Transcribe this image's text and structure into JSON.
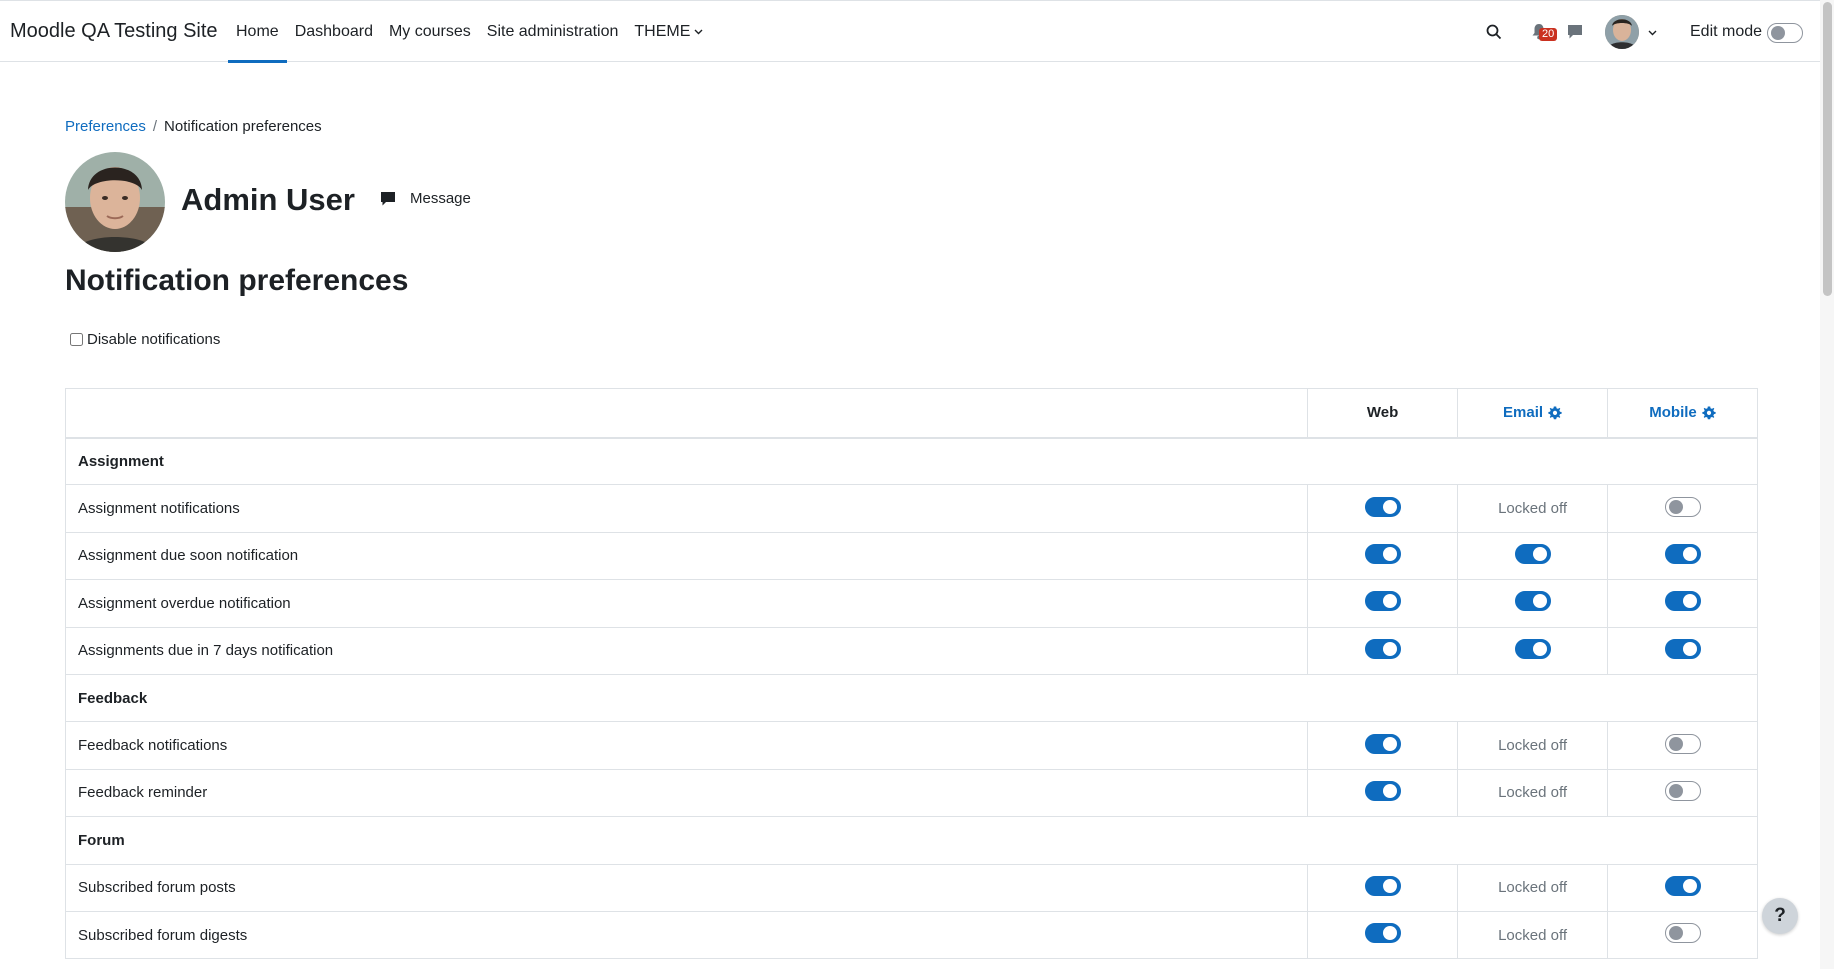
{
  "navbar": {
    "brand": "Moodle QA Testing Site",
    "links": [
      {
        "label": "Home",
        "active": true
      },
      {
        "label": "Dashboard",
        "active": false
      },
      {
        "label": "My courses",
        "active": false
      },
      {
        "label": "Site administration",
        "active": false
      },
      {
        "label": "THEME",
        "active": false
      }
    ],
    "notification_count": "20",
    "edit_mode_label": "Edit mode",
    "edit_mode_on": false
  },
  "breadcrumb": {
    "parent": "Preferences",
    "current": "Notification preferences"
  },
  "profile": {
    "name": "Admin User",
    "message_label": "Message"
  },
  "page_title": "Notification preferences",
  "disable_label": "Disable notifications",
  "table": {
    "headers": {
      "web": "Web",
      "email": "Email",
      "mobile": "Mobile"
    },
    "locked_text": "Locked off",
    "groups": [
      {
        "name": "Assignment",
        "rows": [
          {
            "name": "Assignment notifications",
            "web": "on",
            "email": "locked",
            "mobile": "off"
          },
          {
            "name": "Assignment due soon notification",
            "web": "on",
            "email": "on",
            "mobile": "on"
          },
          {
            "name": "Assignment overdue notification",
            "web": "on",
            "email": "on",
            "mobile": "on"
          },
          {
            "name": "Assignments due in 7 days notification",
            "web": "on",
            "email": "on",
            "mobile": "on"
          }
        ]
      },
      {
        "name": "Feedback",
        "rows": [
          {
            "name": "Feedback notifications",
            "web": "on",
            "email": "locked",
            "mobile": "off"
          },
          {
            "name": "Feedback reminder",
            "web": "on",
            "email": "locked",
            "mobile": "off"
          }
        ]
      },
      {
        "name": "Forum",
        "rows": [
          {
            "name": "Subscribed forum posts",
            "web": "on",
            "email": "locked",
            "mobile": "on"
          },
          {
            "name": "Subscribed forum digests",
            "web": "on",
            "email": "locked",
            "mobile": "off"
          }
        ]
      }
    ]
  },
  "help_label": "?",
  "colors": {
    "accent": "#0f6cbf",
    "badge": "#ca3120"
  }
}
